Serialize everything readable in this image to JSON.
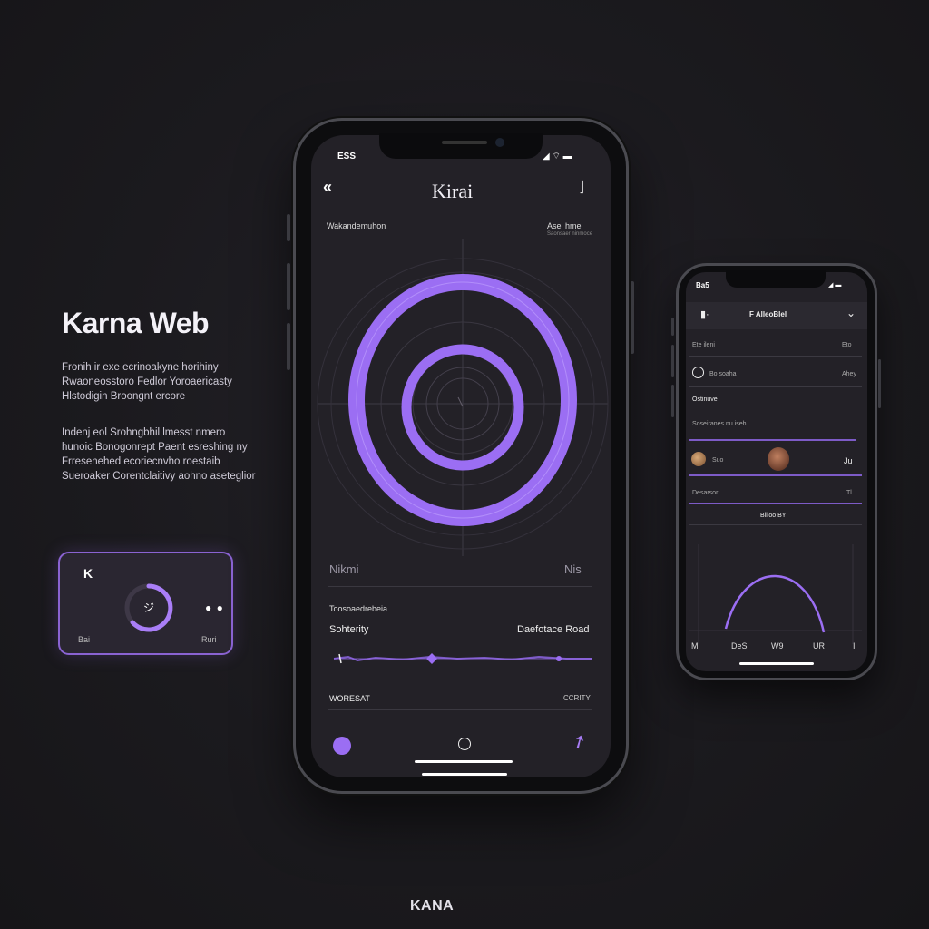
{
  "brand": {
    "title": "Karna Web",
    "paragraph1": "Fronih ir exe ecrinoakyne horihiny Rwaoneosstoro Fedlor Yoroaericasty Hlstodigin Broongnt ercore",
    "paragraph2": "Indenj eol Srohngbhil lmesst nmero hunoic Bonogonrept Paent esreshing ny Frresenehed ecoriecnvho roestaib Sueroaker Corentclaitivy aohno aseteglior",
    "footer": "KANA"
  },
  "mini_card": {
    "letter": "K",
    "ring_text": "ジ",
    "dots_icon": "two-dots-icon",
    "bottom_left": "Bai",
    "bottom_right": "Ruri"
  },
  "main_phone": {
    "status_time": "ESS",
    "app_title": "Kirai",
    "subheader_left": "Wakandemuhon",
    "subheader_right": "Asel hmel",
    "subheader_right_small": "Saonsaer ninmoce",
    "mid_label_left": "Nikmi",
    "mid_label_right": "Nis",
    "section_label": "Toosoaedrebeia",
    "row_label_left": "Sohterity",
    "row_label_right": "Daefotace Road",
    "footer_label_left": "WORESAT",
    "footer_label_right": "CCRITY",
    "accent": "#9b6ef3",
    "slider_value": 0.4
  },
  "right_phone": {
    "status_time": "Ba5",
    "header_title": "F AlleoBlel",
    "row1_left": "Ete ileni",
    "row1_right": "Eto",
    "row2_label": "Bo soaha",
    "row2_right": "Ahey",
    "row3_title": "Ostinuve",
    "row3_sub": "Soseiranes nu iseh",
    "avatar_row_label": "Suo",
    "avatar_row_right": "Ju",
    "row4_label": "Desarsor",
    "row4_right": "Tl",
    "section_title": "Bilioo BY",
    "footer_items": [
      "M",
      "DeS",
      "W9",
      "UR",
      "I"
    ]
  }
}
